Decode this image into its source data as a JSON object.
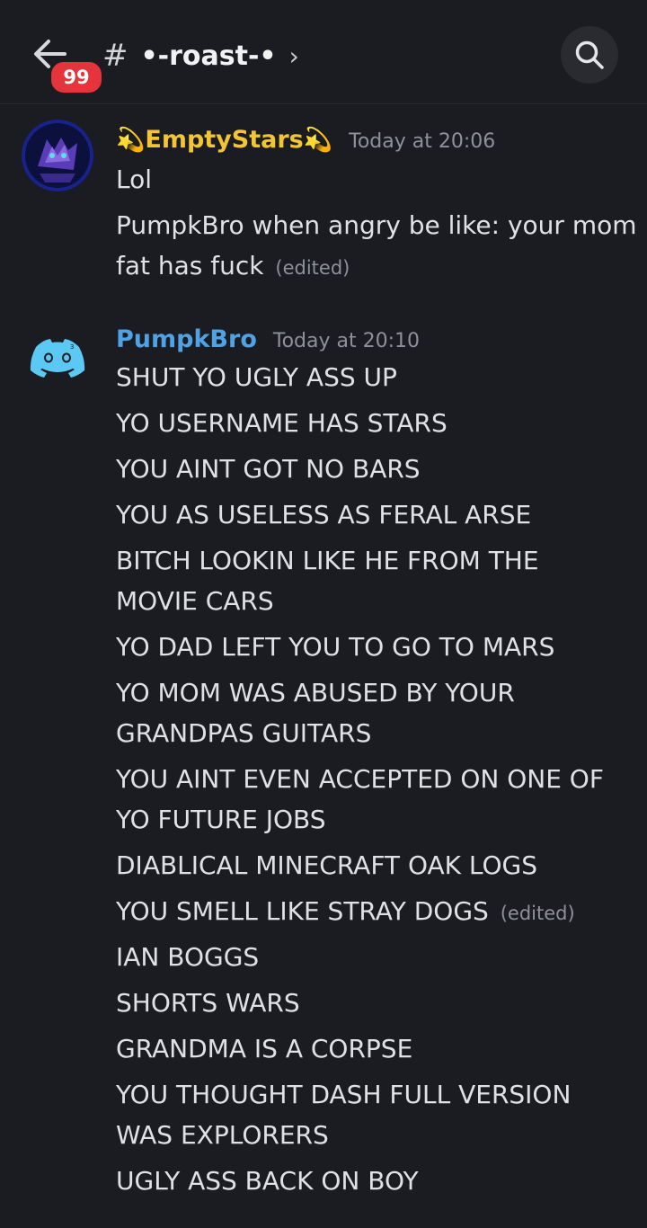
{
  "header": {
    "back_label": "Back",
    "unread_badge": "99",
    "hash": "#",
    "channel_name": "•-roast-•",
    "chevron": "›"
  },
  "messages": [
    {
      "username": "EmptyStars",
      "username_decor": "💫",
      "username_color": "#f4c533",
      "timestamp": "Today at 20:06",
      "lines": [
        "Lol",
        "PumpkBro when angry be like: your mom",
        "fat has fuck"
      ],
      "edited_label": "(edited)"
    },
    {
      "username": "PumpkBro",
      "username_color": "#4fa3e5",
      "timestamp": "Today at 20:10",
      "lines": [
        "SHUT YO UGLY ASS UP",
        "YO USERNAME HAS STARS",
        "YOU AINT GOT NO BARS",
        "YOU AS USELESS AS FERAL ARSE",
        "BITCH LOOKIN LIKE HE FROM THE",
        "MOVIE CARS",
        "YO DAD LEFT YOU TO GO TO MARS",
        "YO MOM WAS ABUSED BY YOUR",
        "GRANDPAS GUITARS",
        "YOU AINT EVEN ACCEPTED ON ONE OF",
        "YO FUTURE JOBS",
        "DIABLICAL MINECRAFT OAK LOGS",
        "YOU SMELL LIKE STRAY DOGS",
        "IAN BOGGS",
        "SHORTS WARS",
        "GRANDMA IS A CORPSE",
        "YOU THOUGHT DASH FULL VERSION",
        "WAS EXPLORERS",
        "UGLY ASS BACK ON BOY"
      ],
      "edited_label": "(edited)"
    }
  ],
  "colors": {
    "background": "#1b1c21",
    "badge": "#e5343c",
    "discord_avatar": "#5cc8f4"
  }
}
